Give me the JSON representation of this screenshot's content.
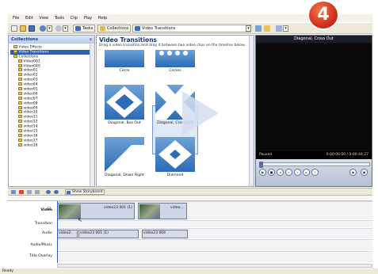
{
  "menu": [
    "File",
    "Edit",
    "View",
    "Tools",
    "Clip",
    "Play",
    "Help"
  ],
  "toolbar": {
    "tasks_label": "Tasks",
    "collections_label": "Collections",
    "location_value": "Video Transitions"
  },
  "step_badge": "4",
  "collections": {
    "title": "Collections",
    "close": "x",
    "tree": [
      {
        "label": "Video Effects",
        "selected": false
      },
      {
        "label": "Video Transitions",
        "selected": true
      },
      {
        "label": "Collections",
        "selected": false
      },
      {
        "label": "Video001",
        "selected": false
      },
      {
        "label": "Video040",
        "selected": false
      },
      {
        "label": "video01",
        "selected": false
      },
      {
        "label": "video02",
        "selected": false
      },
      {
        "label": "video03",
        "selected": false
      },
      {
        "label": "video04",
        "selected": false
      },
      {
        "label": "video05",
        "selected": false
      },
      {
        "label": "video06",
        "selected": false
      },
      {
        "label": "video07",
        "selected": false
      },
      {
        "label": "video08",
        "selected": false
      },
      {
        "label": "video09",
        "selected": false
      },
      {
        "label": "video10",
        "selected": false
      },
      {
        "label": "video11",
        "selected": false
      },
      {
        "label": "video12",
        "selected": false
      },
      {
        "label": "video14",
        "selected": false
      },
      {
        "label": "video15",
        "selected": false
      },
      {
        "label": "video16",
        "selected": false
      },
      {
        "label": "video17",
        "selected": false
      },
      {
        "label": "video18",
        "selected": false
      }
    ]
  },
  "transitions": {
    "title": "Video Transitions",
    "description": "Drag a video transition and drop it between two video clips on the timeline below.",
    "tiles": [
      {
        "label": "Circle"
      },
      {
        "label": "Circles"
      },
      {
        "label": "Diagonal, Box Out"
      },
      {
        "label": "Diagonal, Cross Out"
      },
      {
        "label": "Diagonal, Down Right"
      },
      {
        "label": "Diamond"
      }
    ]
  },
  "preview": {
    "title": "Diagonal, Cross Out",
    "status": "Paused",
    "time": "0:00:00.00 / 0:00:44.27",
    "progress": 0
  },
  "storyboard": {
    "show_label": "Show Storyboard"
  },
  "timeline": {
    "tracks": [
      "Video",
      "Transition",
      "Audio",
      "Audio/Music",
      "Title Overlay"
    ],
    "video_clips": [
      "video23 001 (1)",
      "video..."
    ],
    "audio_clips": [
      "video2..",
      "video23 001 (1)",
      "video23 004"
    ]
  },
  "statusbar": {
    "text": "Ready"
  },
  "colors": {
    "accent": "#2f5fb3",
    "badge": "#d2311b",
    "tile_blue": "#2e6bb4"
  }
}
